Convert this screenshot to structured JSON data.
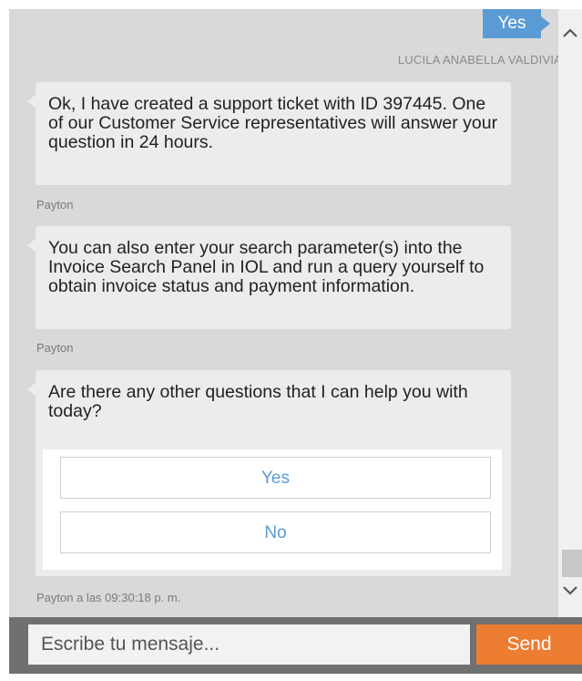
{
  "conversation": {
    "outgoing": {
      "text": "Yes",
      "author": "LUCILA ANABELLA VALDIVIA"
    },
    "messages": [
      {
        "text": "Ok, I have created a support ticket with ID 397445. One of our Customer Service representatives will answer your question in 24 hours.",
        "sender": "Payton"
      },
      {
        "text": "You can also enter your search parameter(s) into the Invoice Search Panel in IOL and run a query yourself to obtain invoice status and payment information.",
        "sender": "Payton"
      },
      {
        "text": "Are there any other questions that I can help you with today?",
        "sender": "Payton a las 09:30:18 p. m.",
        "options": [
          "Yes",
          "No"
        ]
      }
    ]
  },
  "composer": {
    "placeholder": "Escribe tu mensaje...",
    "send_label": "Send"
  },
  "icons": {
    "scroll_up": "chevron-up-icon",
    "scroll_down": "chevron-down-icon"
  },
  "colors": {
    "accent_blue": "#5b9bd5",
    "send_orange": "#ed7d31"
  }
}
